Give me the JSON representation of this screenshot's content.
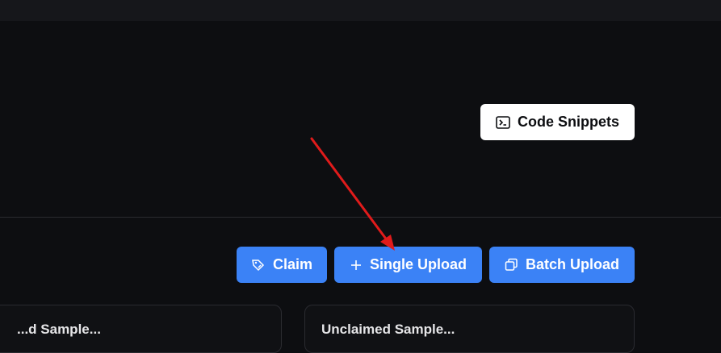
{
  "header": {
    "code_snippets_label": "Code Snippets"
  },
  "toolbar": {
    "claim_label": "Claim",
    "single_upload_label": "Single Upload",
    "batch_upload_label": "Batch Upload"
  },
  "cards": {
    "left_title": "...d Sample...",
    "right_title": "Unclaimed Sample..."
  },
  "icons": {
    "code_snippets": "terminal-icon",
    "claim": "tag-hand-icon",
    "single_upload": "plus-icon",
    "batch_upload": "copy-icon"
  },
  "colors": {
    "background": "#0d0e11",
    "primary": "#3b82f6",
    "annotation": "#e01b1b"
  }
}
